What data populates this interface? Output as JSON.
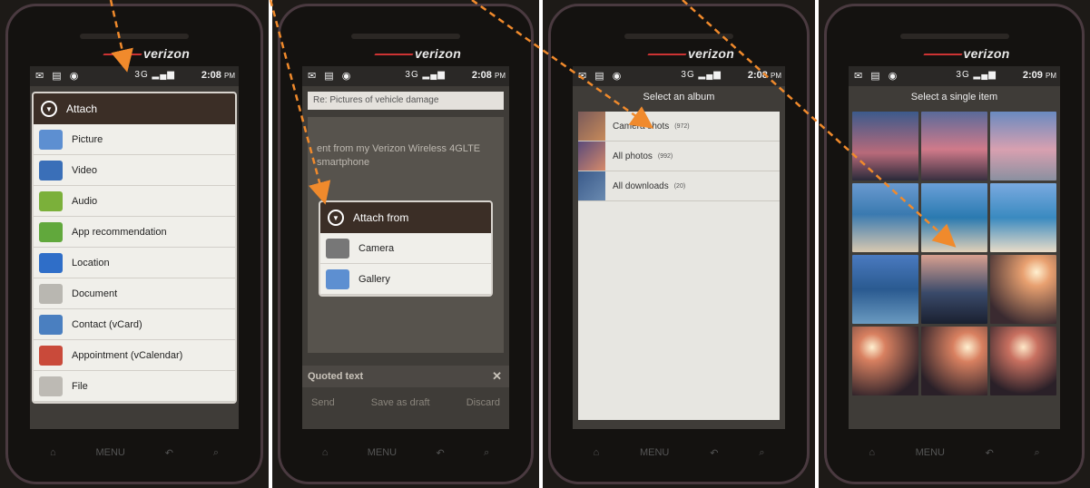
{
  "status": {
    "p1_time": "2:08",
    "p2_time": "2:08",
    "p3_time": "2:08",
    "p4_time": "2:09",
    "ampm": "PM",
    "network": "3G"
  },
  "brand": "verizon",
  "panel1": {
    "dialog_title": "Attach",
    "options": [
      {
        "label": "Picture",
        "icon": "picture-icon",
        "color": "#5d8fd1"
      },
      {
        "label": "Video",
        "icon": "video-icon",
        "color": "#3a6fb8"
      },
      {
        "label": "Audio",
        "icon": "music-note-icon",
        "color": "#7bb03a"
      },
      {
        "label": "App recommendation",
        "icon": "app-recommendation-icon",
        "color": "#61a83c"
      },
      {
        "label": "Location",
        "icon": "location-icon",
        "color": "#2f6ec8"
      },
      {
        "label": "Document",
        "icon": "document-icon",
        "color": "#b9b7b1"
      },
      {
        "label": "Contact (vCard)",
        "icon": "contact-card-icon",
        "color": "#4a7fc0"
      },
      {
        "label": "Appointment (vCalendar)",
        "icon": "calendar-icon",
        "color": "#c94a3a"
      },
      {
        "label": "File",
        "icon": "file-icon",
        "color": "#bdbab4"
      }
    ]
  },
  "panel2": {
    "subject": "Re: Pictures of vehicle damage",
    "body": "ent from my Verizon Wireless 4GLTE smartphone",
    "dialog_title": "Attach from",
    "options": [
      {
        "label": "Camera",
        "icon": "camera-icon",
        "color": "#777"
      },
      {
        "label": "Gallery",
        "icon": "gallery-icon",
        "color": "#5d8fd1"
      }
    ],
    "quoted": "Quoted text",
    "actions": {
      "send": "Send",
      "draft": "Save as draft",
      "discard": "Discard"
    }
  },
  "panel3": {
    "title": "Select an album",
    "albums": [
      {
        "name": "Camera shots",
        "count": "(972)"
      },
      {
        "name": "All photos",
        "count": "(992)"
      },
      {
        "name": "All downloads",
        "count": "(20)"
      }
    ]
  },
  "panel4": {
    "title": "Select a single item"
  },
  "nav": {
    "menu": "MENU"
  },
  "colors": {
    "arrow": "#f08a2c",
    "dialog_header": "#3b2e26"
  }
}
